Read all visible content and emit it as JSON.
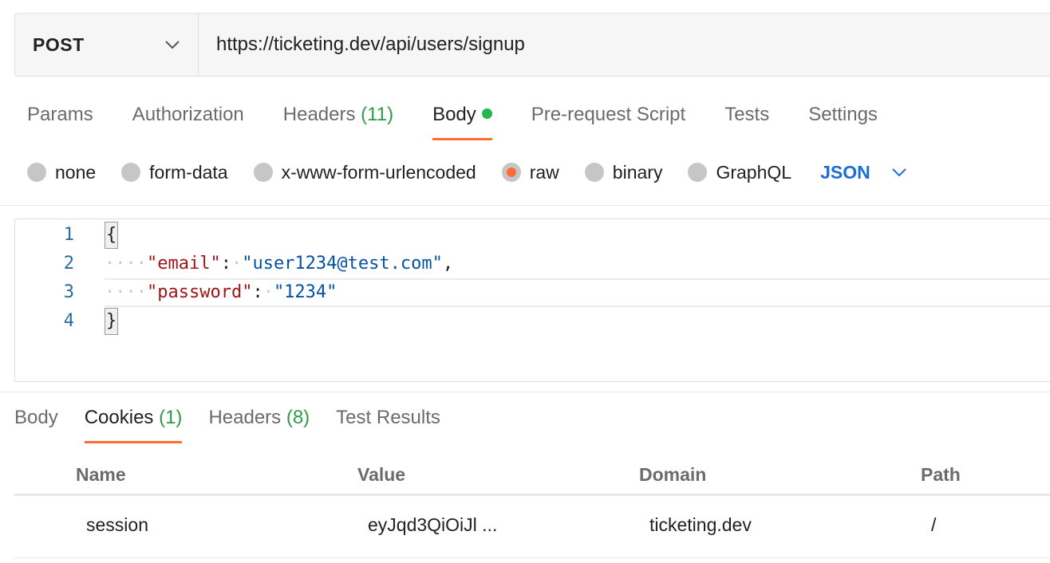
{
  "request": {
    "method": "POST",
    "url": "https://ticketing.dev/api/users/signup"
  },
  "request_tabs": [
    {
      "label": "Params",
      "count": "",
      "active": false
    },
    {
      "label": "Authorization",
      "count": "",
      "active": false
    },
    {
      "label": "Headers",
      "count": "(11)",
      "active": false
    },
    {
      "label": "Body",
      "count": "",
      "active": true,
      "dot": true
    },
    {
      "label": "Pre-request Script",
      "count": "",
      "active": false
    },
    {
      "label": "Tests",
      "count": "",
      "active": false
    },
    {
      "label": "Settings",
      "count": "",
      "active": false
    }
  ],
  "body_types": [
    {
      "label": "none",
      "checked": false
    },
    {
      "label": "form-data",
      "checked": false
    },
    {
      "label": "x-www-form-urlencoded",
      "checked": false
    },
    {
      "label": "raw",
      "checked": true
    },
    {
      "label": "binary",
      "checked": false
    },
    {
      "label": "GraphQL",
      "checked": false
    }
  ],
  "format": "JSON",
  "editor": {
    "line_numbers": [
      "1",
      "2",
      "3",
      "4"
    ],
    "open_brace": "{",
    "close_brace": "}",
    "fields": [
      {
        "key": "\"email\"",
        "value": "\"user1234@test.com\"",
        "trailing": ","
      },
      {
        "key": "\"password\"",
        "value": "\"1234\"",
        "trailing": ""
      }
    ]
  },
  "response_tabs": [
    {
      "label": "Body",
      "count": "",
      "active": false
    },
    {
      "label": "Cookies",
      "count": "(1)",
      "active": true
    },
    {
      "label": "Headers",
      "count": "(8)",
      "active": false
    },
    {
      "label": "Test Results",
      "count": "",
      "active": false
    }
  ],
  "cookies": {
    "columns": [
      "Name",
      "Value",
      "Domain",
      "Path"
    ],
    "rows": [
      {
        "name": "session",
        "value": "eyJqd3QiOiJl ...",
        "domain": "ticketing.dev",
        "path": "/"
      }
    ]
  },
  "colors": {
    "accent": "#ff6c37",
    "count_green": "#2e9a45",
    "status_dot": "#26b550",
    "json_blue": "#1d6ed8",
    "json_key": "#a31515",
    "json_string": "#0451a5"
  },
  "icons": {
    "method_dropdown": "chevron-down-icon",
    "format_dropdown": "chevron-down-icon"
  }
}
